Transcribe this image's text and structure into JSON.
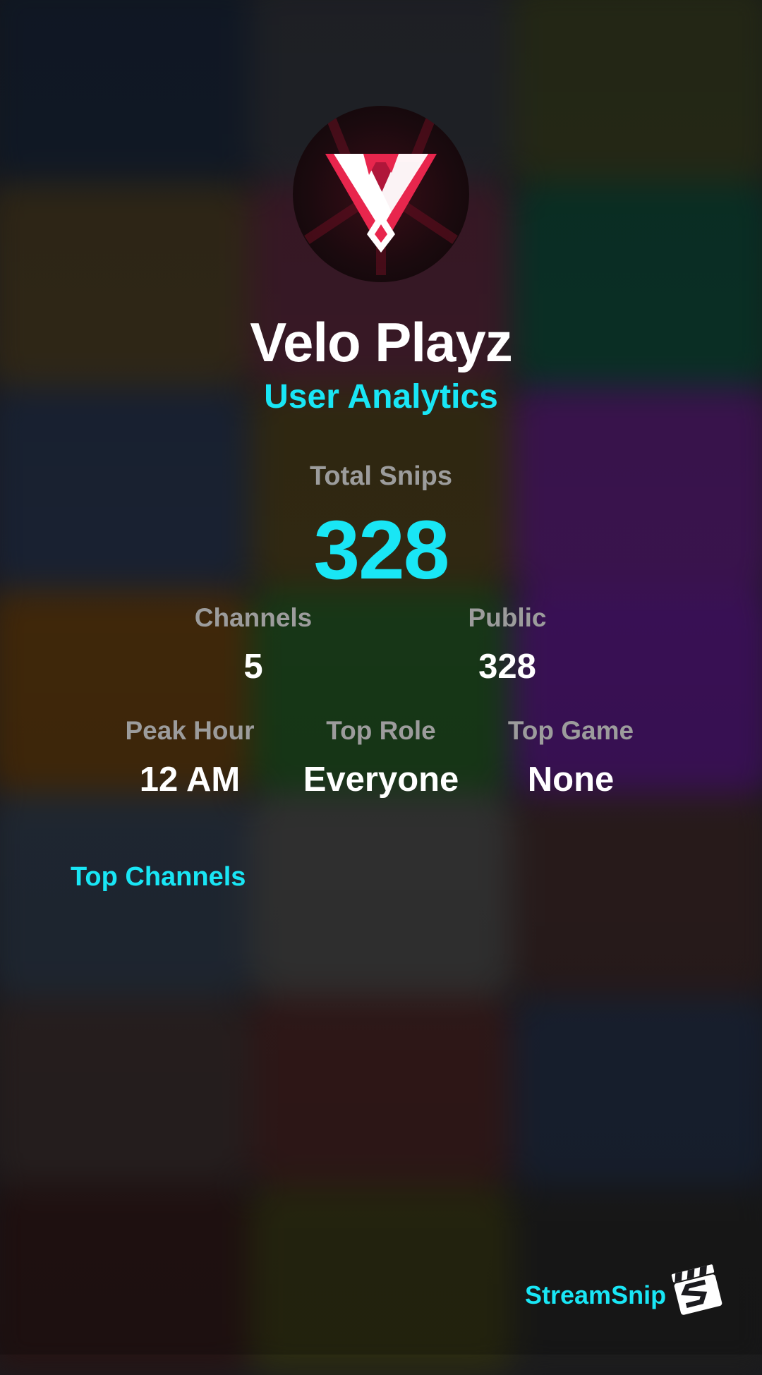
{
  "profile": {
    "name": "Velo Playz",
    "subtitle": "User Analytics",
    "avatar_icon": "velo-logo-icon"
  },
  "total": {
    "label": "Total Snips",
    "value": "328"
  },
  "stats_row1": {
    "channels_label": "Channels",
    "channels_value": "5",
    "public_label": "Public",
    "public_value": "328"
  },
  "stats_row2": {
    "peak_label": "Peak Hour",
    "peak_value": "12 AM",
    "role_label": "Top Role",
    "role_value": "Everyone",
    "game_label": "Top Game",
    "game_value": "None"
  },
  "top_channels": {
    "title": "Top Channels",
    "items": []
  },
  "footer": {
    "brand": "StreamSnip",
    "brand_icon": "clapperboard-icon"
  },
  "colors": {
    "accent": "#19e6f5",
    "label": "#9c9c9c",
    "text": "#ffffff",
    "logo_red": "#e8264d"
  }
}
